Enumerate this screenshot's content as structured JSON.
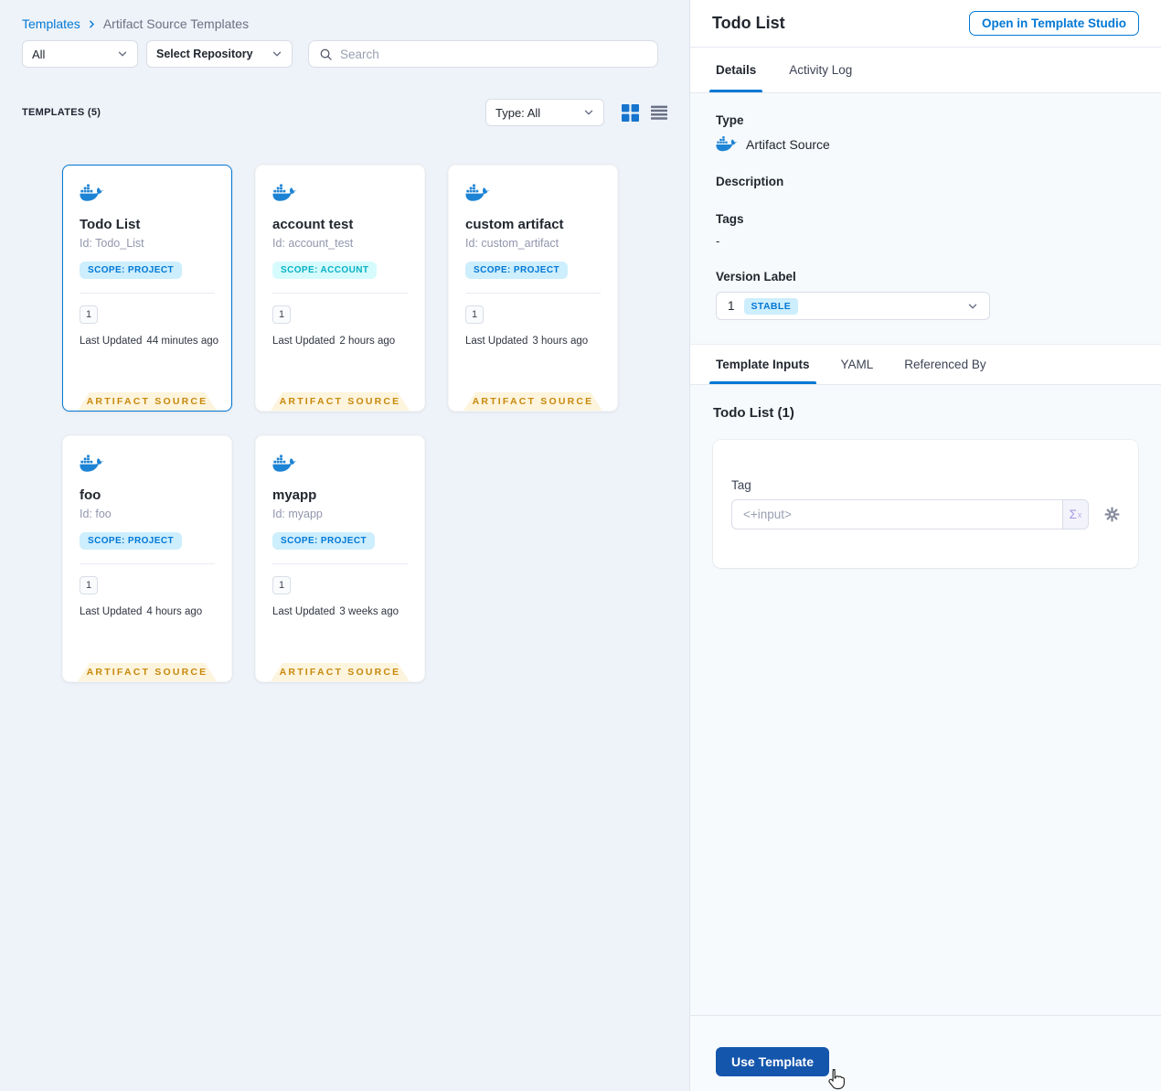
{
  "breadcrumb": {
    "templates": "Templates",
    "current": "Artifact Source Templates"
  },
  "filters": {
    "scope": "All",
    "repository": "Select Repository",
    "search_placeholder": "Search"
  },
  "list_header": {
    "count_label": "TEMPLATES (5)",
    "type_filter": "Type: All"
  },
  "cards_shared": {
    "last_updated_label": "Last Updated",
    "ribbon": "ARTIFACT SOURCE"
  },
  "cards": [
    {
      "title": "Todo List",
      "id": "Id: Todo_List",
      "scope": "SCOPE: PROJECT",
      "scope_kind": "project",
      "version": "1",
      "last_updated": "44 minutes ago",
      "selected": true
    },
    {
      "title": "account test",
      "id": "Id: account_test",
      "scope": "SCOPE: ACCOUNT",
      "scope_kind": "account",
      "version": "1",
      "last_updated": "2 hours ago",
      "selected": false
    },
    {
      "title": "custom artifact",
      "id": "Id: custom_artifact",
      "scope": "SCOPE: PROJECT",
      "scope_kind": "project",
      "version": "1",
      "last_updated": "3 hours ago",
      "selected": false
    },
    {
      "title": "foo",
      "id": "Id: foo",
      "scope": "SCOPE: PROJECT",
      "scope_kind": "project",
      "version": "1",
      "last_updated": "4 hours ago",
      "selected": false
    },
    {
      "title": "myapp",
      "id": "Id: myapp",
      "scope": "SCOPE: PROJECT",
      "scope_kind": "project",
      "version": "1",
      "last_updated": "3 weeks ago",
      "selected": false
    }
  ],
  "panel": {
    "title": "Todo List",
    "open_button": "Open in Template Studio",
    "tabs": [
      "Details",
      "Activity Log"
    ],
    "type_label": "Type",
    "type_value": "Artifact Source",
    "description_label": "Description",
    "tags_label": "Tags",
    "tags_value": "-",
    "version_label": "Version Label",
    "version_value": "1",
    "version_badge": "STABLE",
    "inputs_tabs": [
      "Template Inputs",
      "YAML",
      "Referenced By"
    ],
    "inputs_title": "Todo List (1)",
    "tag_label": "Tag",
    "tag_value": "<+input>",
    "sigma": "Σ",
    "sigma_sup": "x",
    "use_template": "Use Template"
  },
  "icons": {
    "breadcrumb_separator": "chevron-right-icon",
    "search": "search-icon",
    "dropdowns": "chevron-down-icon",
    "grid_view": "grid-view-icon",
    "list_view": "list-view-icon",
    "template_type": "docker-whale-icon",
    "expression": "sigma-expression-icon",
    "settings": "gear-icon",
    "cursor": "hand-pointer-cursor"
  },
  "colors": {
    "accent": "#0278d5",
    "primary_button": "#1456ac",
    "scope_project_bg": "#cdeefc",
    "scope_project_text": "#0278d5",
    "scope_account_bg": "#d6fbfd",
    "scope_account_text": "#07b2c4",
    "ribbon_bg": "#fdf4dd",
    "ribbon_text": "#c8890d",
    "stable_bg": "#cdeefc",
    "stable_text": "#0278d5",
    "left_bg": "#eef3f9",
    "panel_bg": "#f6fafc"
  }
}
